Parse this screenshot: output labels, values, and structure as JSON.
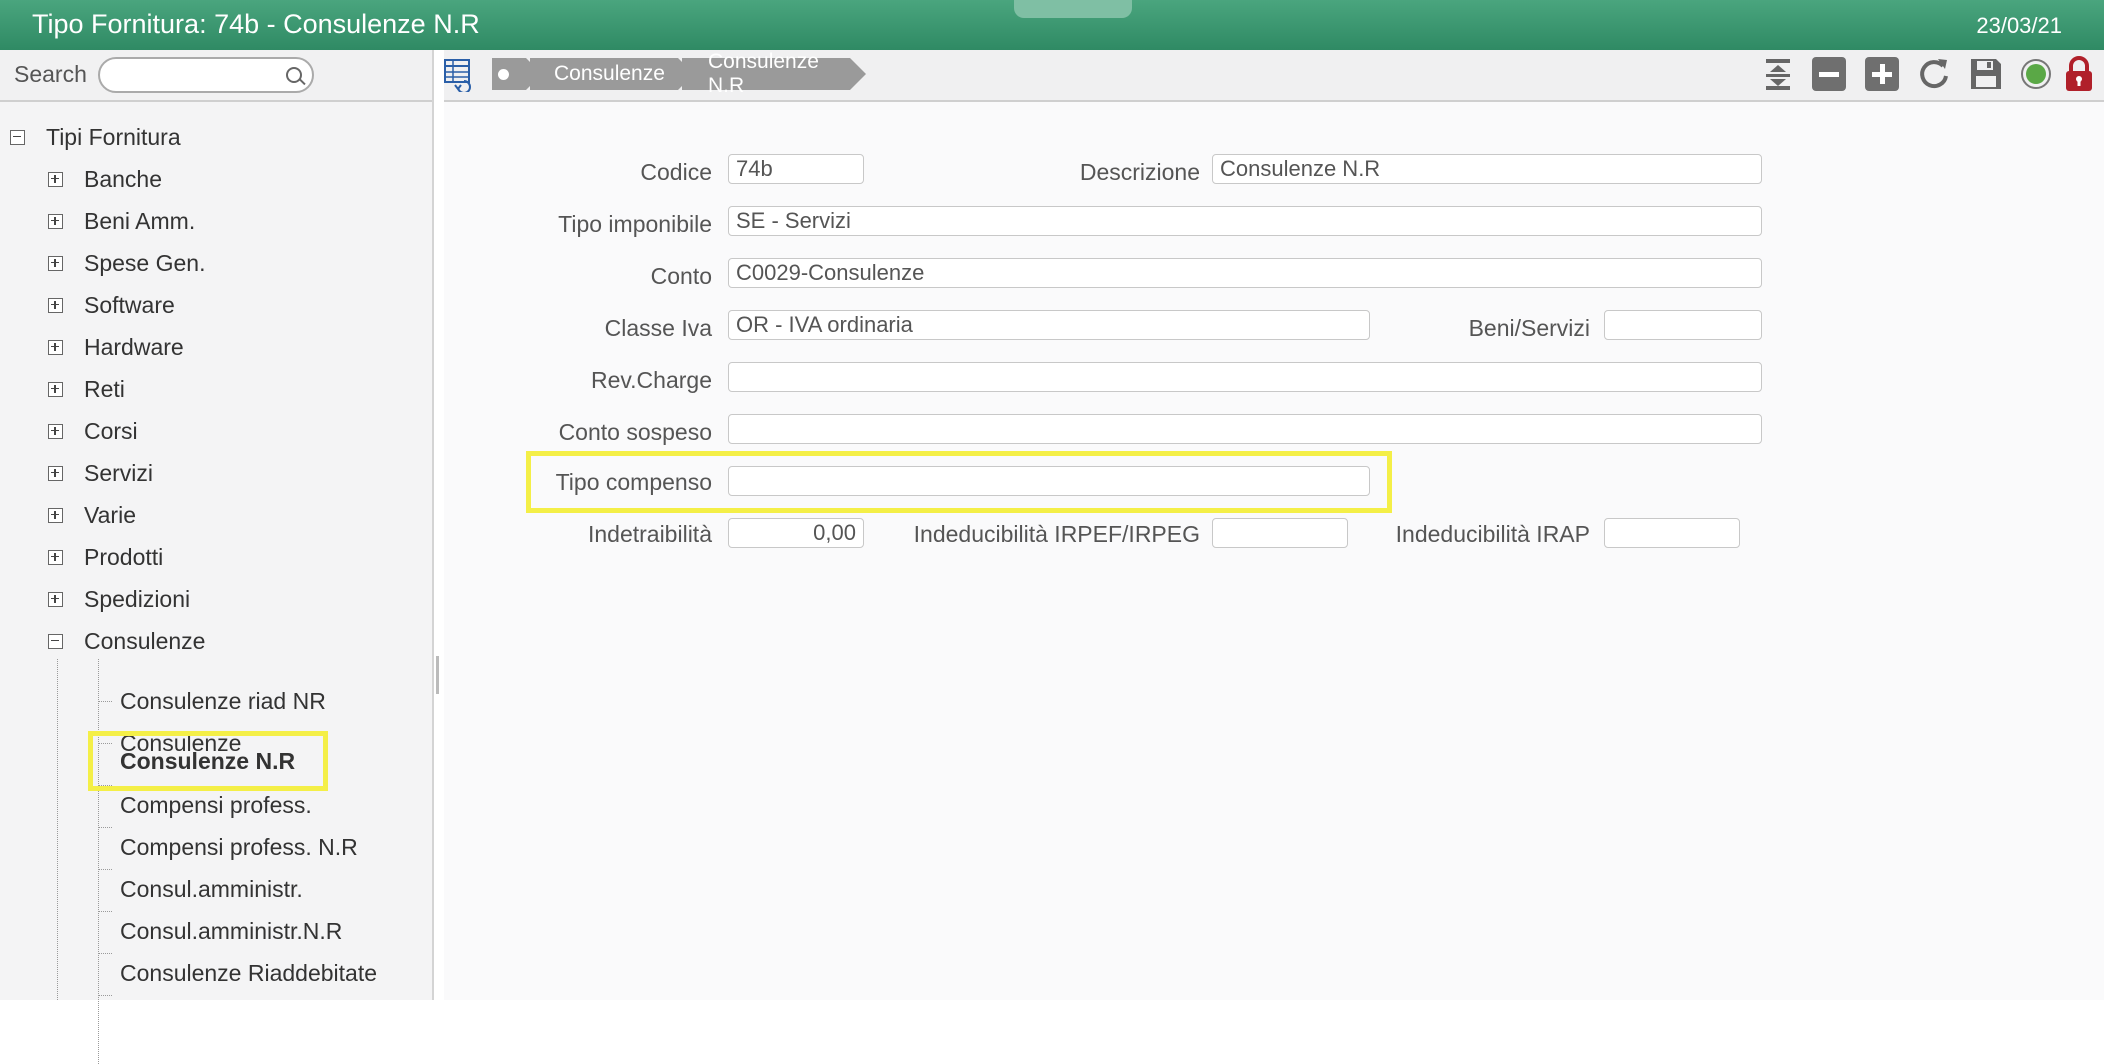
{
  "window": {
    "title": "Tipo Fornitura: 74b - Consulenze N.R",
    "date": "23/03/21"
  },
  "sidebar": {
    "search_label": "Search",
    "search_value": "",
    "tree": {
      "root": "Tipi Fornitura",
      "groups": [
        "Banche",
        "Beni Amm.",
        "Spese Gen.",
        "Software",
        "Hardware",
        "Reti",
        "Corsi",
        "Servizi",
        "Varie",
        "Prodotti",
        "Spedizioni",
        "Consulenze"
      ],
      "consulenze_children": [
        "Consulenze riad NR",
        "Consulenze",
        "Consulenze N.R",
        "Compensi profess.",
        "Compensi profess. N.R",
        "Consul.amministr.",
        "Consul.amministr.N.R",
        "Consulenze Riaddebitate"
      ],
      "selected": "Consulenze N.R"
    }
  },
  "toolbar": {
    "breadcrumb": [
      "Consulenze",
      "Consulenze N.R"
    ],
    "icons": [
      "table-view-icon",
      "collapse-icon",
      "remove-icon",
      "add-icon",
      "refresh-icon",
      "save-icon",
      "status-icon",
      "lock-icon"
    ],
    "colors": {
      "status": "#5aa846",
      "lock": "#b0202a",
      "highlight": "#f4ef47"
    }
  },
  "form": {
    "codice": {
      "label": "Codice",
      "value": "74b"
    },
    "descrizione": {
      "label": "Descrizione",
      "value": "Consulenze N.R"
    },
    "tipo_imponibile": {
      "label": "Tipo imponibile",
      "value": "SE - Servizi"
    },
    "conto": {
      "label": "Conto",
      "value": "C0029-Consulenze"
    },
    "classe_iva": {
      "label": "Classe Iva",
      "value": "OR - IVA ordinaria"
    },
    "beni_servizi": {
      "label": "Beni/Servizi",
      "value": ""
    },
    "rev_charge": {
      "label": "Rev.Charge",
      "value": ""
    },
    "conto_sospeso": {
      "label": "Conto sospeso",
      "value": ""
    },
    "tipo_compenso": {
      "label": "Tipo compenso",
      "value": ""
    },
    "indetraibilita": {
      "label": "Indetraibilità",
      "value": "0,00"
    },
    "indeducibilita_irpef": {
      "label": "Indeducibilità IRPEF/IRPEG",
      "value": ""
    },
    "indeducibilita_irap": {
      "label": "Indeducibilità IRAP",
      "value": ""
    }
  }
}
